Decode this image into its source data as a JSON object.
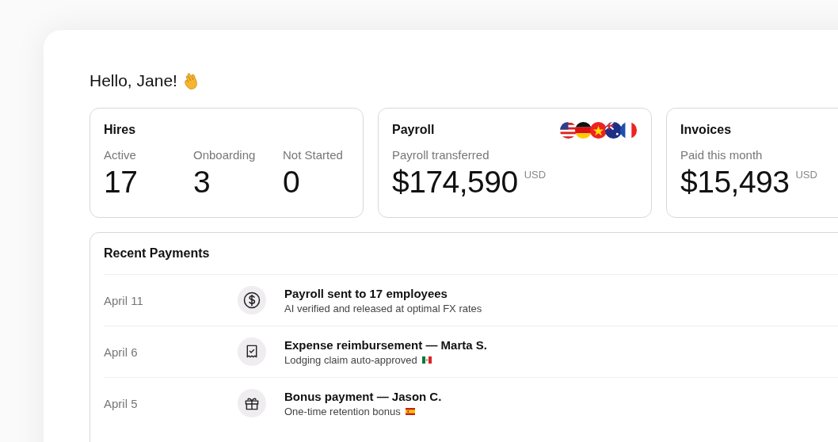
{
  "greeting": "Hello, Jane!",
  "cards": [
    {
      "kind": "stats",
      "title": "Hires",
      "stats": [
        {
          "label": "Active",
          "value": "17"
        },
        {
          "label": "Onboarding",
          "value": "3"
        },
        {
          "label": "Not Started",
          "value": "0"
        }
      ]
    },
    {
      "kind": "amount",
      "title": "Payroll",
      "flags": [
        {
          "kind": "us"
        },
        {
          "kind": "de"
        },
        {
          "kind": "vn"
        },
        {
          "kind": "au"
        },
        {
          "kind": "fr"
        }
      ],
      "label": "Payroll transferred",
      "amount": "$174,590",
      "currency": "USD"
    },
    {
      "kind": "amount",
      "title": "Invoices",
      "label": "Paid this month",
      "amount": "$15,493",
      "currency": "USD"
    }
  ],
  "payments": {
    "title": "Recent Payments",
    "rows": [
      {
        "date": "April 11",
        "kind": "dollar",
        "title": "Payroll sent to 17 employees",
        "subtitle": "AI verified and released at optimal FX rates"
      },
      {
        "date": "April 6",
        "kind": "receipt",
        "title": "Expense reimbursement — Marta S.",
        "subtitle": "Lodging claim auto-approved",
        "flags": [
          {
            "kind": "mx"
          }
        ]
      },
      {
        "date": "April 5",
        "kind": "gift",
        "title": "Bonus payment — Jason C.",
        "subtitle": "One-time retention bonus",
        "flags": [
          {
            "kind": "es"
          }
        ]
      }
    ]
  }
}
